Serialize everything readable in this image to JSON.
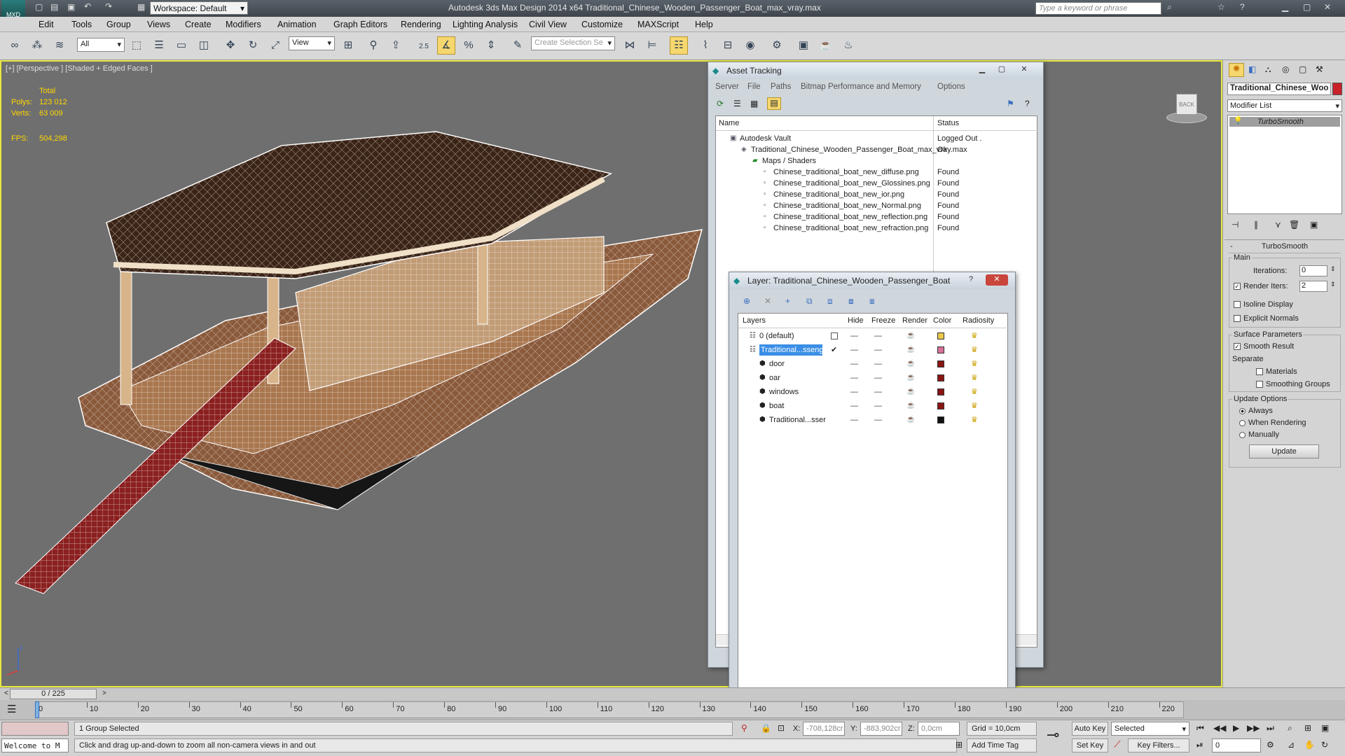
{
  "app": {
    "title": "Autodesk 3ds Max Design 2014 x64      Traditional_Chinese_Wooden_Passenger_Boat_max_vray.max",
    "workspace": "Workspace: Default",
    "search_placeholder": "Type a keyword or phrase"
  },
  "menu": [
    "Edit",
    "Tools",
    "Group",
    "Views",
    "Create",
    "Modifiers",
    "Animation",
    "Graph Editors",
    "Rendering",
    "Lighting Analysis",
    "Civil View",
    "Customize",
    "MAXScript",
    "Help"
  ],
  "toolbar": {
    "filter": "All",
    "refcoord": "View",
    "snap_value": "2.5",
    "selection_set_placeholder": "Create Selection Se"
  },
  "viewport": {
    "label": "[+] [Perspective ] [Shaded + Edged Faces ]",
    "stats": {
      "total_label": "Total",
      "polys_label": "Polys:",
      "polys": "123 012",
      "verts_label": "Verts:",
      "verts": "63 009",
      "fps_label": "FPS:",
      "fps": "504,298"
    },
    "viewcube_label": "BACK"
  },
  "asset_tracking": {
    "title": "Asset Tracking",
    "menu": [
      "Server",
      "File",
      "Paths",
      "Bitmap Performance and Memory",
      "Options"
    ],
    "col_name": "Name",
    "col_status": "Status",
    "rows": [
      {
        "name": "Autodesk Vault",
        "status": "Logged Out ."
      },
      {
        "name": "Traditional_Chinese_Wooden_Passenger_Boat_max_vray.max",
        "status": "Ok"
      },
      {
        "name": "Maps / Shaders",
        "status": ""
      },
      {
        "name": "Chinese_traditional_boat_new_diffuse.png",
        "status": "Found"
      },
      {
        "name": "Chinese_traditional_boat_new_Glossines.png",
        "status": "Found"
      },
      {
        "name": "Chinese_traditional_boat_new_ior.png",
        "status": "Found"
      },
      {
        "name": "Chinese_traditional_boat_new_Normal.png",
        "status": "Found"
      },
      {
        "name": "Chinese_traditional_boat_new_reflection.png",
        "status": "Found"
      },
      {
        "name": "Chinese_traditional_boat_new_refraction.png",
        "status": "Found"
      }
    ]
  },
  "layer_dialog": {
    "title": "Layer: Traditional_Chinese_Wooden_Passenger_Boat",
    "cols": {
      "layers": "Layers",
      "hide": "Hide",
      "freeze": "Freeze",
      "render": "Render",
      "color": "Color",
      "radiosity": "Radiosity"
    },
    "rows": [
      {
        "name": "0 (default)",
        "color": "#e8c84a"
      },
      {
        "name": "Traditional...ssenge",
        "color": "#d8709a"
      },
      {
        "name": "door",
        "color": "#8b1414"
      },
      {
        "name": "oar",
        "color": "#8b1414"
      },
      {
        "name": "windows",
        "color": "#8b1414"
      },
      {
        "name": "boat",
        "color": "#8b1414"
      },
      {
        "name": "Traditional...sser",
        "color": "#111111"
      }
    ]
  },
  "command_panel": {
    "object_name": "Traditional_Chinese_Woo",
    "modifier_list": "Modifier List",
    "stack_item": "TurboSmooth",
    "rollout_title": "TurboSmooth",
    "main_label": "Main",
    "iterations_label": "Iterations:",
    "iterations": "0",
    "render_iters_label": "Render Iters:",
    "render_iters": "2",
    "isoline": "Isoline Display",
    "explicit_normals": "Explicit Normals",
    "surface_params": "Surface Parameters",
    "smooth_result": "Smooth Result",
    "separate": "Separate",
    "materials": "Materials",
    "smoothing_groups": "Smoothing Groups",
    "update_options": "Update Options",
    "always": "Always",
    "when_rendering": "When Rendering",
    "manually": "Manually",
    "update_btn": "Update"
  },
  "timeline": {
    "frame": "0 / 225",
    "ticks": [
      "0",
      "10",
      "20",
      "30",
      "40",
      "50",
      "60",
      "70",
      "80",
      "90",
      "100",
      "110",
      "120",
      "130",
      "140",
      "150",
      "160",
      "170",
      "180",
      "190",
      "200",
      "210",
      "220"
    ]
  },
  "status": {
    "welcome": "Welcome to M",
    "selected": "1 Group Selected",
    "prompt": "Click and drag up-and-down to zoom all non-camera views in and out",
    "x_label": "X:",
    "x": "-708,128cr",
    "y_label": "Y:",
    "y": "-883,902cr",
    "z_label": "Z:",
    "z": "0,0cm",
    "grid": "Grid = 10,0cm",
    "add_time_tag": "Add Time Tag",
    "auto_key": "Auto Key",
    "set_key": "Set Key",
    "selected_dd": "Selected",
    "key_filters": "Key Filters...",
    "frame_field": "0"
  }
}
